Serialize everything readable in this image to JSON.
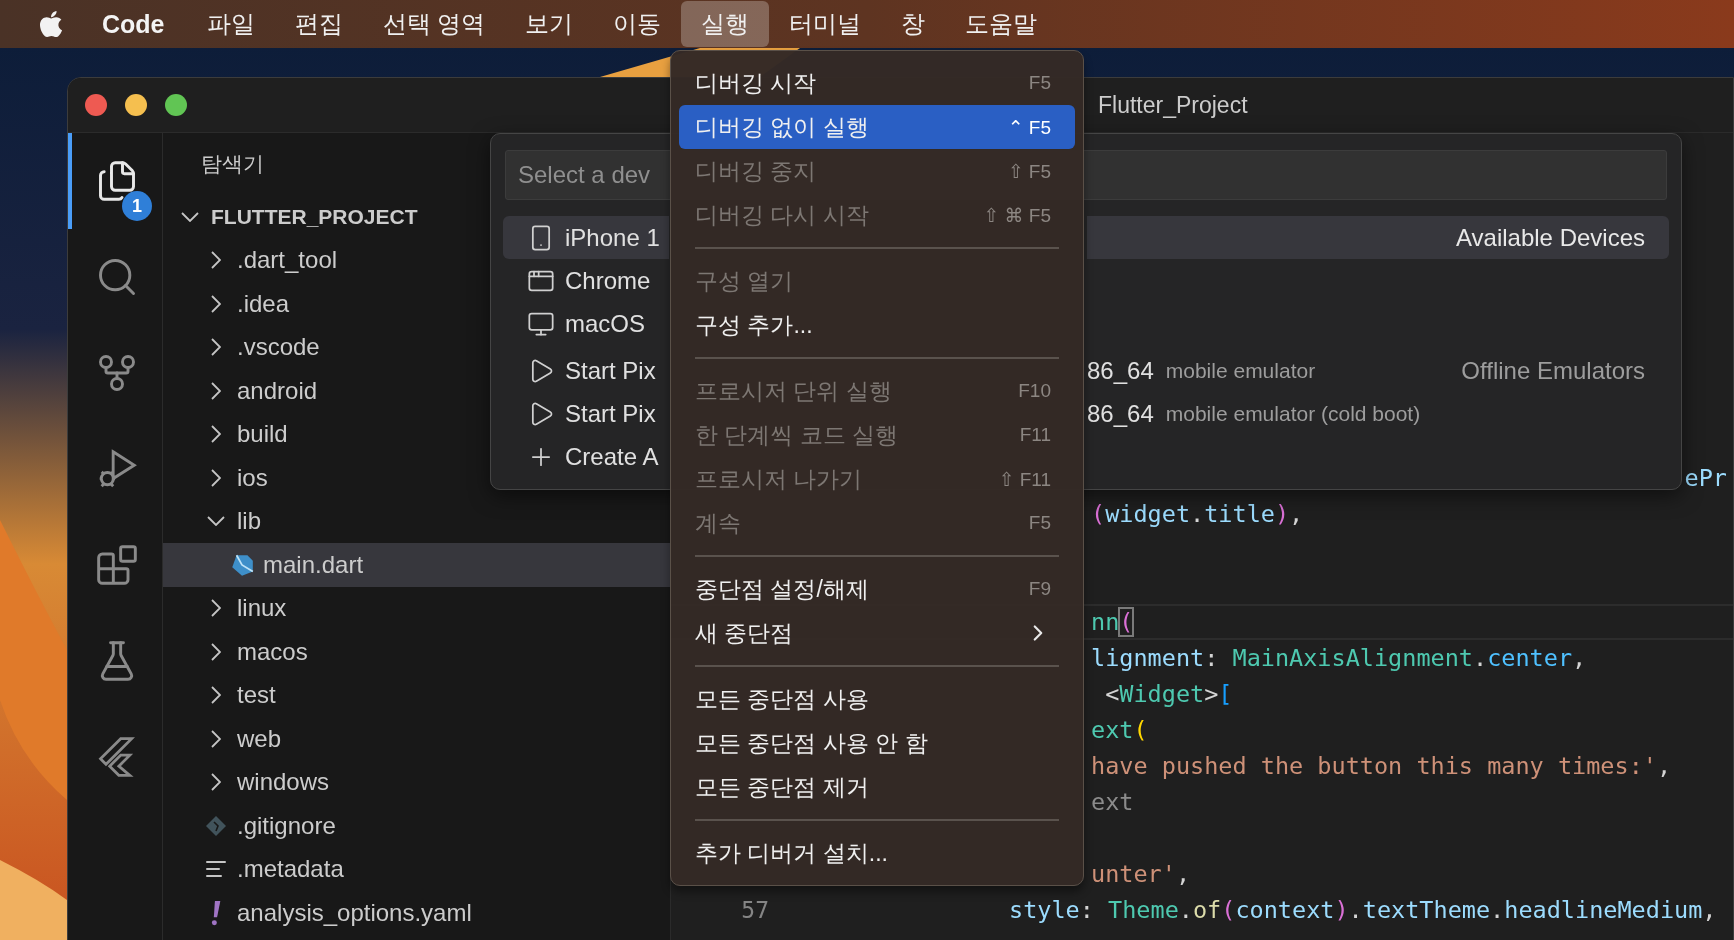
{
  "menubar": {
    "app": "Code",
    "items": [
      {
        "label": "파일",
        "selected": false
      },
      {
        "label": "편집",
        "selected": false
      },
      {
        "label": "선택 영역",
        "selected": false
      },
      {
        "label": "보기",
        "selected": false
      },
      {
        "label": "이동",
        "selected": false
      },
      {
        "label": "실행",
        "selected": true
      },
      {
        "label": "터미널",
        "selected": false
      },
      {
        "label": "창",
        "selected": false
      },
      {
        "label": "도움말",
        "selected": false
      }
    ]
  },
  "window": {
    "title": "Flutter_Project"
  },
  "activity_bar": [
    {
      "kind": "explorer",
      "selected": true,
      "badge": "1"
    },
    {
      "kind": "search",
      "selected": false
    },
    {
      "kind": "source-control",
      "selected": false
    },
    {
      "kind": "run-debug",
      "selected": false
    },
    {
      "kind": "extensions",
      "selected": false
    },
    {
      "kind": "testing",
      "selected": false
    },
    {
      "kind": "flutter",
      "selected": false
    }
  ],
  "sidebar": {
    "title": "탐색기",
    "tree": [
      {
        "label": "FLUTTER_PROJECT",
        "kind": "root",
        "expanded": true,
        "selected": false,
        "children": [
          {
            "label": ".dart_tool",
            "kind": "folder",
            "expanded": false,
            "selected": false
          },
          {
            "label": ".idea",
            "kind": "folder",
            "expanded": false,
            "selected": false
          },
          {
            "label": ".vscode",
            "kind": "folder",
            "expanded": false,
            "selected": false
          },
          {
            "label": "android",
            "kind": "folder",
            "expanded": false,
            "selected": false
          },
          {
            "label": "build",
            "kind": "folder",
            "expanded": false,
            "selected": false
          },
          {
            "label": "ios",
            "kind": "folder",
            "expanded": false,
            "selected": false
          },
          {
            "label": "lib",
            "kind": "folder",
            "expanded": true,
            "selected": false,
            "children": [
              {
                "label": "main.dart",
                "kind": "dart",
                "selected": true
              }
            ]
          },
          {
            "label": "linux",
            "kind": "folder",
            "expanded": false,
            "selected": false
          },
          {
            "label": "macos",
            "kind": "folder",
            "expanded": false,
            "selected": false
          },
          {
            "label": "test",
            "kind": "folder",
            "expanded": false,
            "selected": false
          },
          {
            "label": "web",
            "kind": "folder",
            "expanded": false,
            "selected": false
          },
          {
            "label": "windows",
            "kind": "folder",
            "expanded": false,
            "selected": false
          },
          {
            "label": ".gitignore",
            "kind": "git",
            "selected": false
          },
          {
            "label": ".metadata",
            "kind": "text",
            "selected": false
          },
          {
            "label": "analysis_options.yaml",
            "kind": "yaml",
            "selected": false
          }
        ]
      }
    ]
  },
  "quick_pick": {
    "placeholder": "Select a dev",
    "groups": [
      {
        "label": "Available Devices",
        "rows": [
          {
            "kind": "phone",
            "label": "iPhone 1",
            "selected": true
          },
          {
            "kind": "browser",
            "label": "Chrome",
            "selected": false
          },
          {
            "kind": "desktop",
            "label": "macOS",
            "selected": false
          }
        ]
      },
      {
        "label": "Offline Emulators",
        "rows": [
          {
            "kind": "play",
            "label": "Start Pix",
            "label_end": "86_64",
            "description": "mobile emulator",
            "selected": false
          },
          {
            "kind": "play",
            "label": "Start Pix",
            "label_end": "86_64",
            "description": "mobile emulator (cold boot)",
            "selected": false
          },
          {
            "kind": "plus",
            "label": "Create A",
            "selected": false
          }
        ]
      }
    ]
  },
  "run_menu": [
    {
      "kind": "item",
      "label": "디버깅 시작",
      "shortcut": "F5",
      "disabled": false,
      "selected": false
    },
    {
      "kind": "item",
      "label": "디버깅 없이 실행",
      "shortcut": "⌃ F5",
      "disabled": false,
      "selected": true
    },
    {
      "kind": "item",
      "label": "디버깅 중지",
      "shortcut": "⇧ F5",
      "disabled": true,
      "selected": false
    },
    {
      "kind": "item",
      "label": "디버깅 다시 시작",
      "shortcut": "⇧ ⌘ F5",
      "disabled": true,
      "selected": false
    },
    {
      "kind": "separator"
    },
    {
      "kind": "item",
      "label": "구성 열기",
      "disabled": true,
      "selected": false
    },
    {
      "kind": "item",
      "label": "구성 추가...",
      "disabled": false,
      "selected": false
    },
    {
      "kind": "separator"
    },
    {
      "kind": "item",
      "label": "프로시저 단위 실행",
      "shortcut": "F10",
      "disabled": true,
      "selected": false
    },
    {
      "kind": "item",
      "label": "한 단계씩 코드 실행",
      "shortcut": "F11",
      "disabled": true,
      "selected": false
    },
    {
      "kind": "item",
      "label": "프로시저 나가기",
      "shortcut": "⇧ F11",
      "disabled": true,
      "selected": false
    },
    {
      "kind": "item",
      "label": "계속",
      "shortcut": "F5",
      "disabled": true,
      "selected": false
    },
    {
      "kind": "separator"
    },
    {
      "kind": "item",
      "label": "중단점 설정/해제",
      "shortcut": "F9",
      "disabled": false,
      "selected": false
    },
    {
      "kind": "submenu",
      "label": "새 중단점",
      "disabled": false,
      "selected": false
    },
    {
      "kind": "separator"
    },
    {
      "kind": "item",
      "label": "모든 중단점 사용",
      "disabled": false,
      "selected": false
    },
    {
      "kind": "item",
      "label": "모든 중단점 사용 안 함",
      "disabled": false,
      "selected": false
    },
    {
      "kind": "item",
      "label": "모든 중단점 제거",
      "disabled": false,
      "selected": false
    },
    {
      "kind": "separator"
    },
    {
      "kind": "item",
      "label": "추가 디버거 설치...",
      "disabled": false,
      "selected": false
    }
  ],
  "editor": {
    "lines": [
      {
        "kind": "right",
        "current": false,
        "tokens": [
          {
            "text": "ePr",
            "color": "#9cdcfe"
          }
        ]
      },
      {
        "kind": "clipped",
        "current": false,
        "tokens": [
          {
            "text": "(",
            "color": "#da70d6"
          },
          {
            "text": "widget",
            "color": "#9cdcfe"
          },
          {
            "text": ".",
            "color": "#d4d4d4"
          },
          {
            "text": "title",
            "color": "#9cdcfe"
          },
          {
            "text": ")",
            "color": "#da70d6"
          },
          {
            "text": ",",
            "color": "#d4d4d4"
          }
        ]
      },
      {
        "kind": "blank",
        "current": false
      },
      {
        "kind": "blank",
        "current": false
      },
      {
        "kind": "clipped",
        "current": true,
        "tokens": [
          {
            "text": "nn",
            "color": "#4ec9b0"
          },
          {
            "text": "(",
            "color": "#da70d6"
          }
        ]
      },
      {
        "kind": "clipped",
        "current": false,
        "tokens": [
          {
            "text": "lignment",
            "color": "#9cdcfe"
          },
          {
            "text": ": ",
            "color": "#d4d4d4"
          },
          {
            "text": "MainAxisAlignment",
            "color": "#4ec9b0"
          },
          {
            "text": ".",
            "color": "#d4d4d4"
          },
          {
            "text": "center",
            "color": "#4fc1ff"
          },
          {
            "text": ",",
            "color": "#d4d4d4"
          }
        ]
      },
      {
        "kind": "clipped",
        "current": false,
        "tokens": [
          {
            "text": " <",
            "color": "#d4d4d4"
          },
          {
            "text": "Widget",
            "color": "#4ec9b0"
          },
          {
            "text": ">",
            "color": "#d4d4d4"
          },
          {
            "text": "[",
            "color": "#179fff"
          }
        ]
      },
      {
        "kind": "clipped",
        "current": false,
        "tokens": [
          {
            "text": "ext",
            "color": "#4ec9b0"
          },
          {
            "text": "(",
            "color": "#ffd700"
          }
        ]
      },
      {
        "kind": "clipped",
        "current": false,
        "tokens": [
          {
            "text": "have pushed the button this many times:'",
            "color": "#ce9178"
          },
          {
            "text": ",",
            "color": "#d4d4d4"
          }
        ]
      },
      {
        "kind": "clipped",
        "current": false,
        "tokens": [
          {
            "text": "ext",
            "color": "#8b8b8b"
          }
        ]
      },
      {
        "kind": "blank",
        "current": false
      },
      {
        "kind": "clipped",
        "current": false,
        "tokens": [
          {
            "text": "unter'",
            "color": "#ce9178"
          },
          {
            "text": ",",
            "color": "#d4d4d4"
          }
        ]
      },
      {
        "kind": "full",
        "current": false,
        "number": "57",
        "tokens": [
          {
            "text": "style",
            "color": "#9cdcfe"
          },
          {
            "text": ": ",
            "color": "#d4d4d4"
          },
          {
            "text": "Theme",
            "color": "#4ec9b0"
          },
          {
            "text": ".",
            "color": "#d4d4d4"
          },
          {
            "text": "of",
            "color": "#dcdcaa"
          },
          {
            "text": "(",
            "color": "#da70d6"
          },
          {
            "text": "context",
            "color": "#9cdcfe"
          },
          {
            "text": ")",
            "color": "#da70d6"
          },
          {
            "text": ".",
            "color": "#d4d4d4"
          },
          {
            "text": "textTheme",
            "color": "#9cdcfe"
          },
          {
            "text": ".",
            "color": "#d4d4d4"
          },
          {
            "text": "headlineMedium",
            "color": "#9cdcfe"
          },
          {
            "text": ",",
            "color": "#d4d4d4"
          }
        ]
      }
    ]
  }
}
